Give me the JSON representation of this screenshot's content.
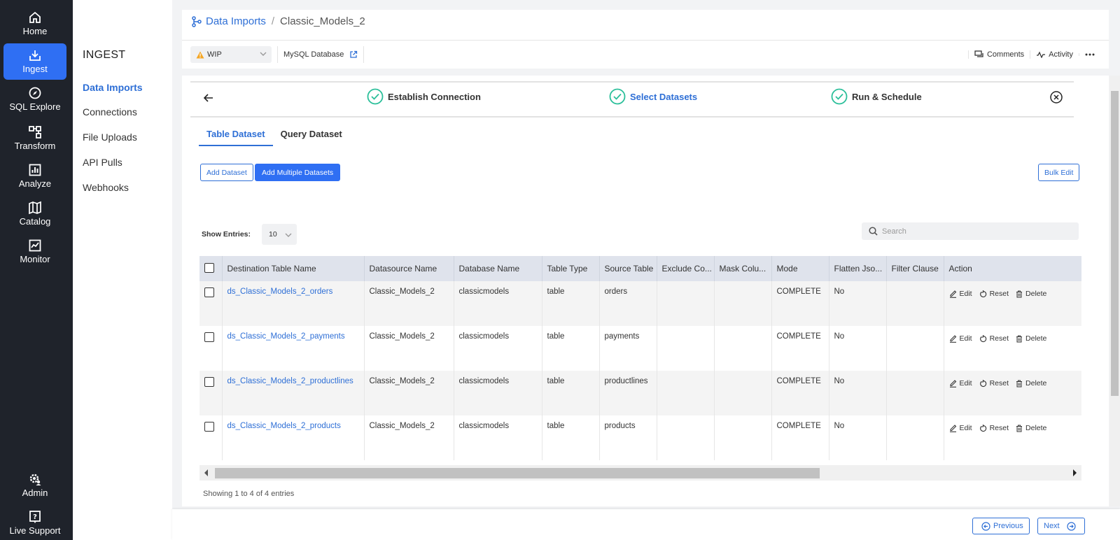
{
  "leftnav": {
    "items": [
      {
        "label": "Home",
        "icon": "home-icon"
      },
      {
        "label": "Ingest",
        "icon": "download-icon"
      },
      {
        "label": "SQL Explore",
        "icon": "compass-icon"
      },
      {
        "label": "Transform",
        "icon": "transform-icon"
      },
      {
        "label": "Analyze",
        "icon": "bar-chart-icon"
      },
      {
        "label": "Catalog",
        "icon": "map-icon"
      },
      {
        "label": "Monitor",
        "icon": "monitor-icon"
      }
    ],
    "admin": "Admin",
    "support": "Live Support"
  },
  "subnav": {
    "title": "INGEST",
    "items": [
      "Data Imports",
      "Connections",
      "File Uploads",
      "API Pulls",
      "Webhooks"
    ]
  },
  "header": {
    "breadcrumb_root": "Data Imports",
    "breadcrumb_sep": "/",
    "breadcrumb_current": "Classic_Models_2",
    "status": "WIP",
    "source": "MySQL Database",
    "comments": "Comments",
    "activity": "Activity"
  },
  "stepper": {
    "steps": [
      "Establish Connection",
      "Select Datasets",
      "Run & Schedule"
    ]
  },
  "tabs": [
    "Table Dataset",
    "Query Dataset"
  ],
  "buttons": {
    "add_dataset": "Add Dataset",
    "add_multiple": "Add Multiple Datasets",
    "bulk_edit": "Bulk Edit"
  },
  "entries": {
    "label": "Show Entries:",
    "value": "10"
  },
  "search": {
    "placeholder": "Search"
  },
  "table": {
    "columns": [
      "Destination Table Name",
      "Datasource Name",
      "Database Name",
      "Table Type",
      "Source Table",
      "Exclude Co...",
      "Mask Colu...",
      "Mode",
      "Flatten Jso...",
      "Filter Clause",
      "Action"
    ],
    "rows": [
      [
        "ds_Classic_Models_2_orders",
        "Classic_Models_2",
        "classicmodels",
        "table",
        "orders",
        "",
        "",
        "COMPLETE",
        "No",
        ""
      ],
      [
        "ds_Classic_Models_2_payments",
        "Classic_Models_2",
        "classicmodels",
        "table",
        "payments",
        "",
        "",
        "COMPLETE",
        "No",
        ""
      ],
      [
        "ds_Classic_Models_2_productlines",
        "Classic_Models_2",
        "classicmodels",
        "table",
        "productlines",
        "",
        "",
        "COMPLETE",
        "No",
        ""
      ],
      [
        "ds_Classic_Models_2_products",
        "Classic_Models_2",
        "classicmodels",
        "table",
        "products",
        "",
        "",
        "COMPLETE",
        "No",
        ""
      ]
    ],
    "actions": {
      "edit": "Edit",
      "reset": "Reset",
      "delete": "Delete"
    }
  },
  "showing": "Showing 1 to 4 of 4 entries",
  "footer": {
    "previous": "Previous",
    "next": "Next"
  },
  "colors": {
    "nav_bg": "#1f232b",
    "accent": "#2f6ff3",
    "link": "#2e6fd6",
    "success": "#2bbf9a",
    "warning": "#f5a623"
  }
}
